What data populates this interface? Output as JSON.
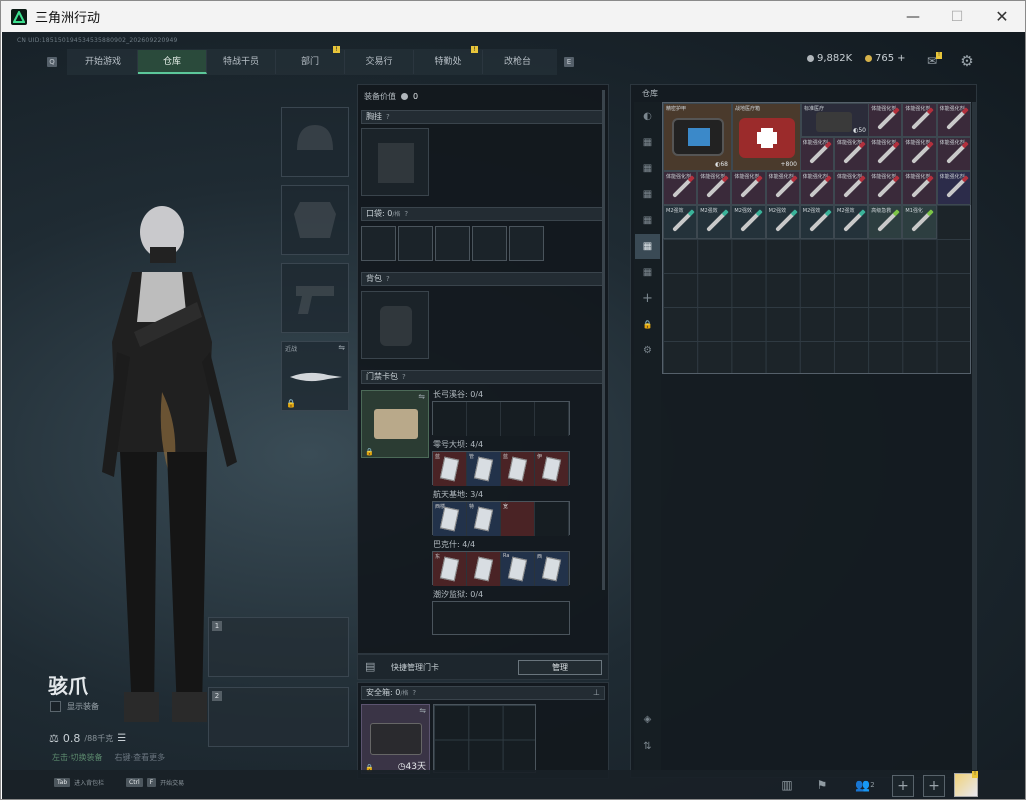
{
  "window": {
    "title": "三角洲行动",
    "minimize": "—",
    "maximize": "☐",
    "close": "✕"
  },
  "uid": "CN UID:18515019453453588090­2_202609220949",
  "nav": {
    "left_key": "Q",
    "right_key": "E",
    "tabs": [
      {
        "label": "开始游戏",
        "badge": ""
      },
      {
        "label": "仓库",
        "badge": ""
      },
      {
        "label": "特战干员",
        "badge": ""
      },
      {
        "label": "部门",
        "badge": "!"
      },
      {
        "label": "交易行",
        "badge": ""
      },
      {
        "label": "特勤处",
        "badge": "!"
      },
      {
        "label": "改枪台",
        "badge": ""
      }
    ],
    "active_index": 1
  },
  "currency": {
    "silver": "9,882K",
    "gold": "765",
    "gold_plus": "+",
    "mail_badge": "!"
  },
  "character": {
    "name": "骇爪",
    "show_equipment": "显示装备",
    "weight": "0.8",
    "weight_max": "/88千克",
    "hint_left": "左击·切换装备",
    "hint_right": "右键·查看更多"
  },
  "equip": {
    "melee_label": "近战",
    "slot1": "1",
    "slot2": "2"
  },
  "center": {
    "equip_value_label": "装备价值",
    "equip_value": "0",
    "chest_rig": "胸挂",
    "pocket": "口袋: 0",
    "pocket_unit": "/格",
    "backpack": "背包",
    "keycard_pack": "门禁卡包",
    "card_rows": [
      {
        "label": "长弓溪谷: 0/4",
        "cards": [
          {
            "name": "",
            "color": "empty"
          },
          {
            "name": "",
            "color": "empty"
          },
          {
            "name": "",
            "color": "empty"
          },
          {
            "name": "",
            "color": "empty"
          }
        ]
      },
      {
        "label": "零号大坝: 4/4",
        "cards": [
          {
            "name": "蓝",
            "color": "red"
          },
          {
            "name": "管",
            "color": "blue"
          },
          {
            "name": "蓝",
            "color": "red"
          },
          {
            "name": "伊",
            "color": "red"
          }
        ]
      },
      {
        "label": "航天基地: 3/4",
        "cards": [
          {
            "name": "西楼",
            "color": "blue"
          },
          {
            "name": "特",
            "color": "blue"
          },
          {
            "name": "宽",
            "color": "red"
          },
          {
            "name": "",
            "color": "empty"
          }
        ]
      },
      {
        "label": "巴克什: 4/4",
        "cards": [
          {
            "name": "东",
            "color": "red"
          },
          {
            "name": "",
            "color": "red"
          },
          {
            "name": "Ra",
            "color": "blue"
          },
          {
            "name": "西",
            "color": "blue"
          }
        ]
      },
      {
        "label": "潮汐监狱: 0/4",
        "cards": []
      }
    ],
    "quick_manage": "快捷管理门卡",
    "manage_btn": "管理",
    "safe_box": "安全箱: 0",
    "safe_unit": "/格",
    "safe_timer": "43天"
  },
  "storage": {
    "title": "仓库",
    "items_big": [
      {
        "name": "精密护甲",
        "qty": "68"
      },
      {
        "name": "战地医疗箱",
        "qty": "800"
      },
      {
        "name": "标准医疗",
        "qty": "50"
      }
    ],
    "syringe_name": "体能强化剂",
    "m2_name": "M2强效",
    "m2_label": "M2强心",
    "m2_label2": "M2强心",
    "m2_label3": "M2强心",
    "m2_label4": "M2强心",
    "m2_label5": "M2强化",
    "m2_label6": "M2强化",
    "hp_name": "高级急救",
    "m1_name": "M1强化"
  },
  "bottom": {
    "tab_key": "Tab",
    "tab_label": "进入背包栏",
    "ctrl_key": "Ctrl",
    "ctrl_key2": "F",
    "ctrl_label": "开始交易",
    "friends_count": "2"
  }
}
